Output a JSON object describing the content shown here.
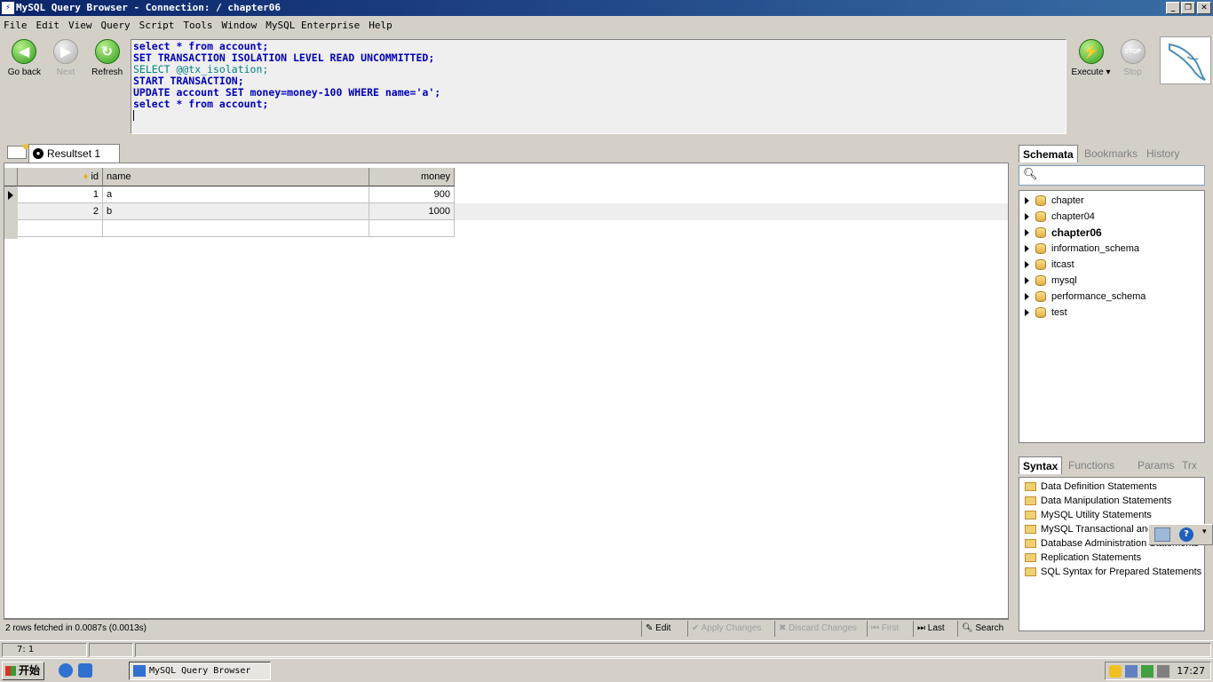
{
  "window": {
    "title": "MySQL Query Browser - Connection:  / chapter06"
  },
  "menu": [
    "File",
    "Edit",
    "View",
    "Query",
    "Script",
    "Tools",
    "Window",
    "MySQL Enterprise",
    "Help"
  ],
  "toolbar": {
    "go_back": "Go back",
    "next": "Next",
    "refresh": "Refresh",
    "execute": "Execute ▾",
    "stop": "Stop"
  },
  "sql": {
    "lines": [
      "select * from account;",
      "SET TRANSACTION ISOLATION LEVEL READ UNCOMMITTED;",
      "SELECT @@tx_isolation;",
      "START TRANSACTION;",
      "UPDATE account SET money=money-100 WHERE name='a';",
      "select * from account;"
    ]
  },
  "resultset": {
    "tab_label": "Resultset 1",
    "columns": [
      "id",
      "name",
      "money"
    ],
    "rows": [
      [
        "1",
        "a",
        "900"
      ],
      [
        "2",
        "b",
        "1000"
      ]
    ],
    "status": "2 rows fetched in 0.0087s (0.0013s)",
    "buttons": {
      "edit": "Edit",
      "apply": "Apply Changes",
      "discard": "Discard Changes",
      "first": "First",
      "last": "Last",
      "search": "Search"
    }
  },
  "statusbar": {
    "position": "7:   1"
  },
  "schemata": {
    "tabs": [
      "Schemata",
      "Bookmarks",
      "History"
    ],
    "items": [
      "chapter",
      "chapter04",
      "chapter06",
      "information_schema",
      "itcast",
      "mysql",
      "performance_schema",
      "test"
    ],
    "active": "chapter06"
  },
  "syntax": {
    "tabs": [
      "Syntax",
      "Functions",
      "Params",
      "Trx"
    ],
    "items": [
      "Data Definition Statements",
      "Data Manipulation Statements",
      "MySQL Utility Statements",
      "MySQL Transactional and",
      "Database Administration Statements",
      "Replication Statements",
      "SQL Syntax for Prepared Statements"
    ]
  },
  "taskbar": {
    "start": "开始",
    "task": "MySQL Query Browser",
    "clock": "17:27"
  }
}
